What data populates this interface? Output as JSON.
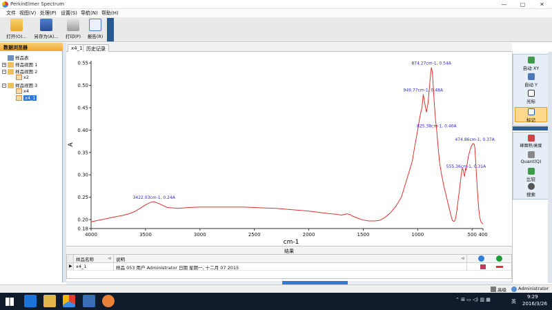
{
  "window": {
    "title": "PerkinElmer Spectrum",
    "controls": [
      "—",
      "▢",
      "✕"
    ]
  },
  "menu": [
    "文件",
    "视图(V)",
    "处理(P)",
    "设置(S)",
    "导航(N)",
    "帮助(H)"
  ],
  "toolbar": {
    "open": "打开(O)...",
    "save_as": "另存为(A)...",
    "print": "打印(P)",
    "report": "报告(R)"
  },
  "left_panel": {
    "title": "数据浏览器",
    "tree": [
      "样品表",
      "样品视图 1",
      "样品视图 2",
      "x2",
      "样品视图 3",
      "x4",
      "x4_1"
    ]
  },
  "tabs": [
    "x4_1",
    "历史记录"
  ],
  "chart_data": {
    "type": "line",
    "xlabel": "cm-1",
    "ylabel": "A",
    "x_reversed": true,
    "xlim": [
      4000,
      400
    ],
    "ylim": [
      0.18,
      0.555
    ],
    "x_ticks": [
      4000,
      3500,
      3000,
      2500,
      2000,
      1500,
      1000,
      500,
      400
    ],
    "x_tick_labels": [
      "4000",
      "3500",
      "3000",
      "2500",
      "2000",
      "1500",
      "1000",
      "500",
      "400"
    ],
    "y_ticks": [
      0.55,
      0.5,
      0.45,
      0.4,
      0.35,
      0.3,
      0.25,
      0.2,
      0.18
    ],
    "y_tick_labels": [
      "0.55",
      "0.50",
      "0.45",
      "0.40",
      "0.35",
      "0.30",
      "0.25",
      "0.20",
      "0.18"
    ],
    "line_color": "#e03030",
    "annotation_color": "#2a2ad0",
    "series": [
      {
        "x": [
          4000,
          3900,
          3800,
          3700,
          3650,
          3600,
          3550,
          3500,
          3450,
          3422,
          3380,
          3300,
          3200,
          3100,
          3000,
          2900,
          2800,
          2700,
          2600,
          2500,
          2400,
          2300,
          2200,
          2100,
          2000,
          1900,
          1800,
          1750,
          1700,
          1680,
          1650,
          1620,
          1600,
          1550,
          1500,
          1450,
          1400,
          1350,
          1300,
          1250,
          1200,
          1150,
          1100,
          1050,
          1030,
          1000,
          980,
          960,
          949,
          935,
          920,
          905,
          890,
          880,
          874,
          865,
          855,
          845,
          835,
          825,
          815,
          800,
          780,
          760,
          740,
          720,
          700,
          690,
          680,
          670,
          660,
          650,
          640,
          630,
          620,
          610,
          600,
          590,
          580,
          575,
          570,
          560,
          555,
          545,
          535,
          520,
          505,
          490,
          480,
          475,
          470,
          460,
          450,
          440,
          430,
          420,
          410,
          400
        ],
        "y": [
          0.195,
          0.2,
          0.205,
          0.21,
          0.213,
          0.218,
          0.225,
          0.233,
          0.239,
          0.24,
          0.236,
          0.227,
          0.225,
          0.227,
          0.228,
          0.228,
          0.228,
          0.228,
          0.228,
          0.227,
          0.226,
          0.225,
          0.223,
          0.221,
          0.219,
          0.216,
          0.213,
          0.212,
          0.21,
          0.211,
          0.213,
          0.211,
          0.208,
          0.203,
          0.199,
          0.197,
          0.197,
          0.198,
          0.205,
          0.215,
          0.23,
          0.25,
          0.29,
          0.33,
          0.36,
          0.4,
          0.43,
          0.45,
          0.48,
          0.46,
          0.44,
          0.46,
          0.5,
          0.53,
          0.54,
          0.53,
          0.49,
          0.45,
          0.42,
          0.4,
          0.37,
          0.33,
          0.3,
          0.275,
          0.255,
          0.235,
          0.215,
          0.205,
          0.198,
          0.196,
          0.197,
          0.205,
          0.22,
          0.24,
          0.26,
          0.28,
          0.3,
          0.315,
          0.31,
          0.3,
          0.297,
          0.315,
          0.31,
          0.325,
          0.34,
          0.355,
          0.365,
          0.37,
          0.368,
          0.36,
          0.34,
          0.3,
          0.26,
          0.225,
          0.205,
          0.196,
          0.192,
          0.19
        ]
      }
    ],
    "annotations": [
      {
        "x": 3422.03,
        "y": 0.24,
        "text": "3422.03cm-1, 0.24A"
      },
      {
        "x": 949.77,
        "y": 0.48,
        "text": "949.77cm-1, 0.48A"
      },
      {
        "x": 874.27,
        "y": 0.54,
        "text": "874.27cm-1, 0.54A"
      },
      {
        "x": 825.38,
        "y": 0.4,
        "text": "825.38cm-1, 0.40A"
      },
      {
        "x": 474.86,
        "y": 0.37,
        "text": "474.86cm-1, 0.37A"
      },
      {
        "x": 555.36,
        "y": 0.31,
        "text": "555.36cm-1, 0.31A"
      }
    ]
  },
  "results": {
    "title": "结果",
    "col_name": "样品名称",
    "col_desc": "说明",
    "rows": [
      {
        "name": "x4_1",
        "desc": "样品 053 用户 Administrator 日期 星期一, 十二月 07 2015"
      }
    ]
  },
  "right_panel": {
    "group1": [
      "自动 XY",
      "自动 Y",
      "光标",
      "标记"
    ],
    "group2": [
      "峰面积/高度",
      "Quant(Q)",
      "比较",
      "搜索"
    ]
  },
  "status": {
    "mode": "高级",
    "user": "Administrator"
  },
  "taskbar": {
    "time": "9:29",
    "date": "2016/3/26",
    "ime": "英"
  },
  "colors": {
    "accent": "#2f5f97",
    "selected": "#2c7ad6",
    "panel_header": "#f2a531"
  }
}
